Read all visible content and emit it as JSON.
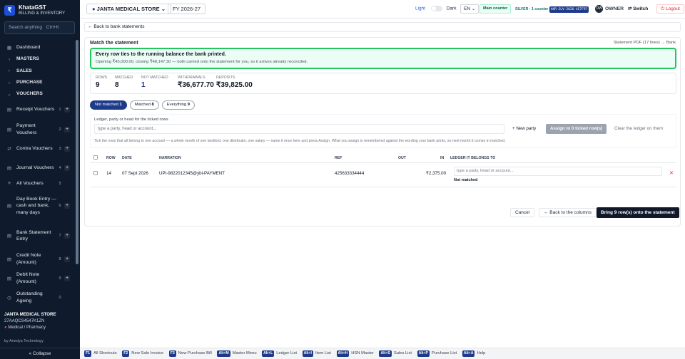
{
  "brand": {
    "logo": "₹",
    "title": "KhataGST",
    "subtitle": "BILLING & INVENTORY"
  },
  "search": {
    "placeholder": "Search anything",
    "shortcut": "Ctrl+K"
  },
  "sidebar": {
    "items": [
      {
        "label": "Dashboard",
        "icon": "grid-icon",
        "type": "item"
      },
      {
        "label": "MASTERS",
        "icon": "chevron-right-icon",
        "type": "head"
      },
      {
        "label": "SALES",
        "icon": "chevron-right-icon",
        "type": "head"
      },
      {
        "label": "PURCHASE",
        "icon": "chevron-right-icon",
        "type": "head"
      },
      {
        "label": "VOUCHERS",
        "icon": "chevron-down-icon",
        "type": "head"
      },
      {
        "label": "Receipt Vouchers",
        "icon": "receipt-icon",
        "count": "1",
        "type": "sub"
      },
      {
        "label": "Payment Vouchers",
        "icon": "payment-icon",
        "count": "2",
        "type": "sub"
      },
      {
        "label": "Contra Vouchers",
        "icon": "contra-icon",
        "count": "3",
        "type": "sub"
      },
      {
        "label": "Journal Vouchers",
        "icon": "journal-icon",
        "count": "4",
        "type": "sub"
      },
      {
        "label": "All Vouchers",
        "icon": "list-icon",
        "count": "5",
        "type": "sub"
      },
      {
        "label": "Day Book Entry — cash and bank, many days",
        "icon": "daybook-icon",
        "count": "6",
        "type": "sub"
      },
      {
        "label": "Bank Statement Entry",
        "icon": "bank-icon",
        "count": "7",
        "type": "sub"
      },
      {
        "label": "Credit Note (Amount)",
        "icon": "credit-note-icon",
        "count": "8",
        "type": "sub"
      },
      {
        "label": "Debit Note (Amount)",
        "icon": "debit-note-icon",
        "count": "9",
        "type": "sub"
      },
      {
        "label": "Outstanding Ageing",
        "icon": "ageing-icon",
        "count": "0",
        "type": "sub"
      }
    ]
  },
  "store_info": {
    "name": "JANTA MEDICAL STORE",
    "gstin": "27AAQCS4547K1ZN",
    "type": "Medical / Pharmacy"
  },
  "by": "by Anedya Technology",
  "collapse_label": "« Collapse",
  "topbar": {
    "store": "JANTA MEDICAL STORE",
    "fy": "FY 2026-27",
    "light": "Light",
    "dark": "Dark",
    "lang": "EN",
    "counter": "Main counter",
    "licence": "SILVER · 1 counter",
    "licence_key": "AKR-SLV-2026-4E7F97",
    "avatar": "OW",
    "owner": "OWNER",
    "switch": "Switch",
    "logout": "Logout"
  },
  "main": {
    "back_label": "Back to bank statements",
    "panel_title": "Match the statement",
    "panel_link": "Statement PDF (17 lines) → Bank",
    "banner_title": "Every row ties to the running balance the bank printed.",
    "banner_sub": "Opening ₹45,000.00, closing ₹48,147.30 — both carried onto the statement for you, so it arrives already reconciled.",
    "stats": [
      {
        "label": "ROWS",
        "value": "9"
      },
      {
        "label": "MATCHED",
        "value": "8"
      },
      {
        "label": "NOT MATCHED",
        "value": "1"
      },
      {
        "label": "WITHDRAWALS",
        "value": "₹36,677.70"
      },
      {
        "label": "DEPOSITS",
        "value": "₹39,825.00"
      }
    ],
    "filters": [
      {
        "label": "Not matched",
        "count": "1"
      },
      {
        "label": "Matched",
        "count": "8"
      },
      {
        "label": "Everything",
        "count": "9"
      }
    ],
    "ledger_label": "Ledger, party or head for the ticked rows",
    "ledger_placeholder": "type a party, head or account...",
    "new_party": "+ New party",
    "assign": "Assign to 0 ticked row(s)",
    "clear": "Clear the ledger on them",
    "ledger_help": "Tick the rows that all belong to one account — a whole month of one landlord, one distributor, one salary — name it once here and press Assign. What you assign is remembered against the wording your bank prints, so next month it comes in matched.",
    "columns": {
      "row": "ROW",
      "date": "DATE",
      "narration": "NARRATION",
      "ref": "REF",
      "out": "OUT",
      "in": "IN",
      "ledger": "LEDGER IT BELONGS TO"
    },
    "rows": [
      {
        "row": "14",
        "date": "07 Sept 2026",
        "narration": "UPI-9822012345@ybl-PAYMENT",
        "ref": "425633334444",
        "out": "",
        "in": "₹2,375.00",
        "ledger_placeholder": "type a party, head or account...",
        "status": "Not matched"
      }
    ],
    "cancel": "Cancel",
    "back_columns": "← Back to the columns",
    "bring": "Bring 9 row(s) onto the statement"
  },
  "shortcuts": [
    {
      "key": "F1",
      "label": "All Shortcuts"
    },
    {
      "key": "F2",
      "label": "New Sale Invoice"
    },
    {
      "key": "F3",
      "label": "New Purchase Bill"
    },
    {
      "key": "Alt+M",
      "label": "Master Menu"
    },
    {
      "key": "Alt+L",
      "label": "Ledger List"
    },
    {
      "key": "Alt+I",
      "label": "Item List"
    },
    {
      "key": "Alt+H",
      "label": "HSN Master"
    },
    {
      "key": "Alt+S",
      "label": "Sales List"
    },
    {
      "key": "Alt+P",
      "label": "Purchase List"
    },
    {
      "key": "Alt+A",
      "label": "Help"
    }
  ],
  "colors": {
    "sidebar_bg": "#0f1b2d",
    "accent": "#1e3a8a",
    "success": "#22c55e",
    "danger": "#dc2626"
  }
}
